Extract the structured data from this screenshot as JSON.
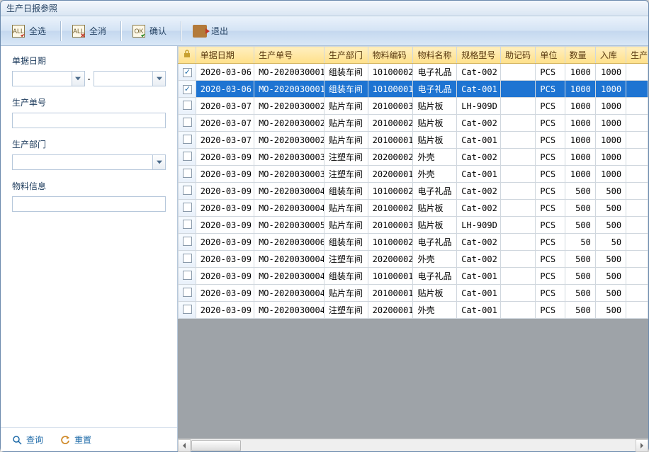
{
  "window": {
    "title": "生产日报参照"
  },
  "toolbar": {
    "select_all": {
      "label": "全选",
      "icon": "ALL"
    },
    "deselect_all": {
      "label": "全消",
      "icon": "ALL"
    },
    "confirm": {
      "label": "确认",
      "icon": "OK"
    },
    "exit": {
      "label": "退出"
    }
  },
  "filters": {
    "date": {
      "label": "单据日期",
      "from": "",
      "to": "",
      "sep": "-"
    },
    "mo_no": {
      "label": "生产单号",
      "value": ""
    },
    "dept": {
      "label": "生产部门",
      "value": ""
    },
    "item": {
      "label": "物料信息",
      "value": ""
    }
  },
  "sidebar_footer": {
    "search": "查询",
    "reset": "重置"
  },
  "grid": {
    "columns": {
      "date": "单据日期",
      "mo_no": "生产单号",
      "dept": "生产部门",
      "item_no": "物料编码",
      "item_name": "物料名称",
      "spec": "规格型号",
      "mnemonic": "助记码",
      "unit": "单位",
      "qty": "数量",
      "in_qty": "入库",
      "prod": "生产"
    },
    "rows": [
      {
        "checked": true,
        "selected": false,
        "date": "2020-03-06",
        "mo_no": "MO-2020030001",
        "dept": "组装车间",
        "item_no": "10100002",
        "item_name": "电子礼品",
        "spec": "Cat-002",
        "mnemonic": "",
        "unit": "PCS",
        "qty": "1000",
        "in_qty": "1000"
      },
      {
        "checked": true,
        "selected": true,
        "date": "2020-03-06",
        "mo_no": "MO-2020030001",
        "dept": "组装车间",
        "item_no": "10100001",
        "item_name": "电子礼品",
        "spec": "Cat-001",
        "mnemonic": "",
        "unit": "PCS",
        "qty": "1000",
        "in_qty": "1000"
      },
      {
        "checked": false,
        "selected": false,
        "date": "2020-03-07",
        "mo_no": "MO-2020030002",
        "dept": "贴片车间",
        "item_no": "20100003",
        "item_name": "贴片板",
        "spec": "LH-909D",
        "mnemonic": "",
        "unit": "PCS",
        "qty": "1000",
        "in_qty": "1000"
      },
      {
        "checked": false,
        "selected": false,
        "date": "2020-03-07",
        "mo_no": "MO-2020030002",
        "dept": "贴片车间",
        "item_no": "20100002",
        "item_name": "贴片板",
        "spec": "Cat-002",
        "mnemonic": "",
        "unit": "PCS",
        "qty": "1000",
        "in_qty": "1000"
      },
      {
        "checked": false,
        "selected": false,
        "date": "2020-03-07",
        "mo_no": "MO-2020030002",
        "dept": "贴片车间",
        "item_no": "20100001",
        "item_name": "贴片板",
        "spec": "Cat-001",
        "mnemonic": "",
        "unit": "PCS",
        "qty": "1000",
        "in_qty": "1000"
      },
      {
        "checked": false,
        "selected": false,
        "date": "2020-03-09",
        "mo_no": "MO-2020030003",
        "dept": "注塑车间",
        "item_no": "20200002",
        "item_name": "外壳",
        "spec": "Cat-002",
        "mnemonic": "",
        "unit": "PCS",
        "qty": "1000",
        "in_qty": "1000"
      },
      {
        "checked": false,
        "selected": false,
        "date": "2020-03-09",
        "mo_no": "MO-2020030003",
        "dept": "注塑车间",
        "item_no": "20200001",
        "item_name": "外壳",
        "spec": "Cat-001",
        "mnemonic": "",
        "unit": "PCS",
        "qty": "1000",
        "in_qty": "1000"
      },
      {
        "checked": false,
        "selected": false,
        "date": "2020-03-09",
        "mo_no": "MO-2020030004",
        "dept": "组装车间",
        "item_no": "10100002",
        "item_name": "电子礼品",
        "spec": "Cat-002",
        "mnemonic": "",
        "unit": "PCS",
        "qty": "500",
        "in_qty": "500"
      },
      {
        "checked": false,
        "selected": false,
        "date": "2020-03-09",
        "mo_no": "MO-2020030004",
        "dept": "贴片车间",
        "item_no": "20100002",
        "item_name": "贴片板",
        "spec": "Cat-002",
        "mnemonic": "",
        "unit": "PCS",
        "qty": "500",
        "in_qty": "500"
      },
      {
        "checked": false,
        "selected": false,
        "date": "2020-03-09",
        "mo_no": "MO-2020030005",
        "dept": "贴片车间",
        "item_no": "20100003",
        "item_name": "贴片板",
        "spec": "LH-909D",
        "mnemonic": "",
        "unit": "PCS",
        "qty": "500",
        "in_qty": "500"
      },
      {
        "checked": false,
        "selected": false,
        "date": "2020-03-09",
        "mo_no": "MO-2020030006",
        "dept": "组装车间",
        "item_no": "10100002",
        "item_name": "电子礼品",
        "spec": "Cat-002",
        "mnemonic": "",
        "unit": "PCS",
        "qty": "50",
        "in_qty": "50"
      },
      {
        "checked": false,
        "selected": false,
        "date": "2020-03-09",
        "mo_no": "MO-2020030004",
        "dept": "注塑车间",
        "item_no": "20200002",
        "item_name": "外壳",
        "spec": "Cat-002",
        "mnemonic": "",
        "unit": "PCS",
        "qty": "500",
        "in_qty": "500"
      },
      {
        "checked": false,
        "selected": false,
        "date": "2020-03-09",
        "mo_no": "MO-2020030004",
        "dept": "组装车间",
        "item_no": "10100001",
        "item_name": "电子礼品",
        "spec": "Cat-001",
        "mnemonic": "",
        "unit": "PCS",
        "qty": "500",
        "in_qty": "500"
      },
      {
        "checked": false,
        "selected": false,
        "date": "2020-03-09",
        "mo_no": "MO-2020030004",
        "dept": "贴片车间",
        "item_no": "20100001",
        "item_name": "贴片板",
        "spec": "Cat-001",
        "mnemonic": "",
        "unit": "PCS",
        "qty": "500",
        "in_qty": "500"
      },
      {
        "checked": false,
        "selected": false,
        "date": "2020-03-09",
        "mo_no": "MO-2020030004",
        "dept": "注塑车间",
        "item_no": "20200001",
        "item_name": "外壳",
        "spec": "Cat-001",
        "mnemonic": "",
        "unit": "PCS",
        "qty": "500",
        "in_qty": "500"
      }
    ]
  }
}
